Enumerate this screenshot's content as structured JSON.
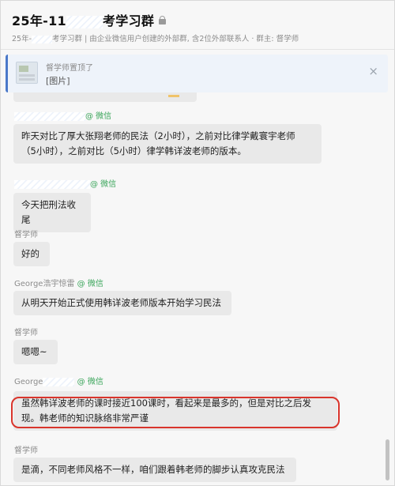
{
  "header": {
    "title_prefix": "25年-11",
    "title_suffix": "考学习群",
    "subtitle_prefix": "25年-",
    "subtitle_middle": "考学习群",
    "subtitle_suffix": " | 由企业微信用户创建的外部群, 含2位外部联系人 · 群主: 督学师"
  },
  "pinned": {
    "label": "督学师置顶了",
    "content": "[图片]",
    "close_glyph": "×"
  },
  "messages": [
    {
      "sender": "",
      "sender_tag": "@ 微信",
      "lines": [
        "昨天对比了厚大张翔老师的民法（2小时），之前对比律学戴寰宇老师",
        "（5小时），之前对比（5小时）律学韩详波老师的版本。"
      ]
    },
    {
      "sender": "",
      "sender_tag": "@ 微信",
      "lines": [
        "今天把刑法收尾"
      ]
    },
    {
      "sender": "督学师",
      "sender_tag": "",
      "lines": [
        "好的"
      ]
    },
    {
      "sender": "George浩宇惊雷",
      "sender_tag": " @ 微信",
      "lines": [
        "从明天开始正式使用韩详波老师版本开始学习民法"
      ]
    },
    {
      "sender": "督学师",
      "sender_tag": "",
      "lines": [
        "嗯嗯~"
      ]
    },
    {
      "sender": "George",
      "sender_tag": " @ 微信",
      "lines": [
        "虽然韩详波老师的课时接近100课时，看起来是最多的，但是对比之后发",
        "现。韩老师的知识脉络非常严谨"
      ]
    },
    {
      "sender": "督学师",
      "sender_tag": "",
      "lines": [
        "是滴，不同老师风格不一样，咱们跟着韩老师的脚步认真攻克民法"
      ]
    }
  ]
}
